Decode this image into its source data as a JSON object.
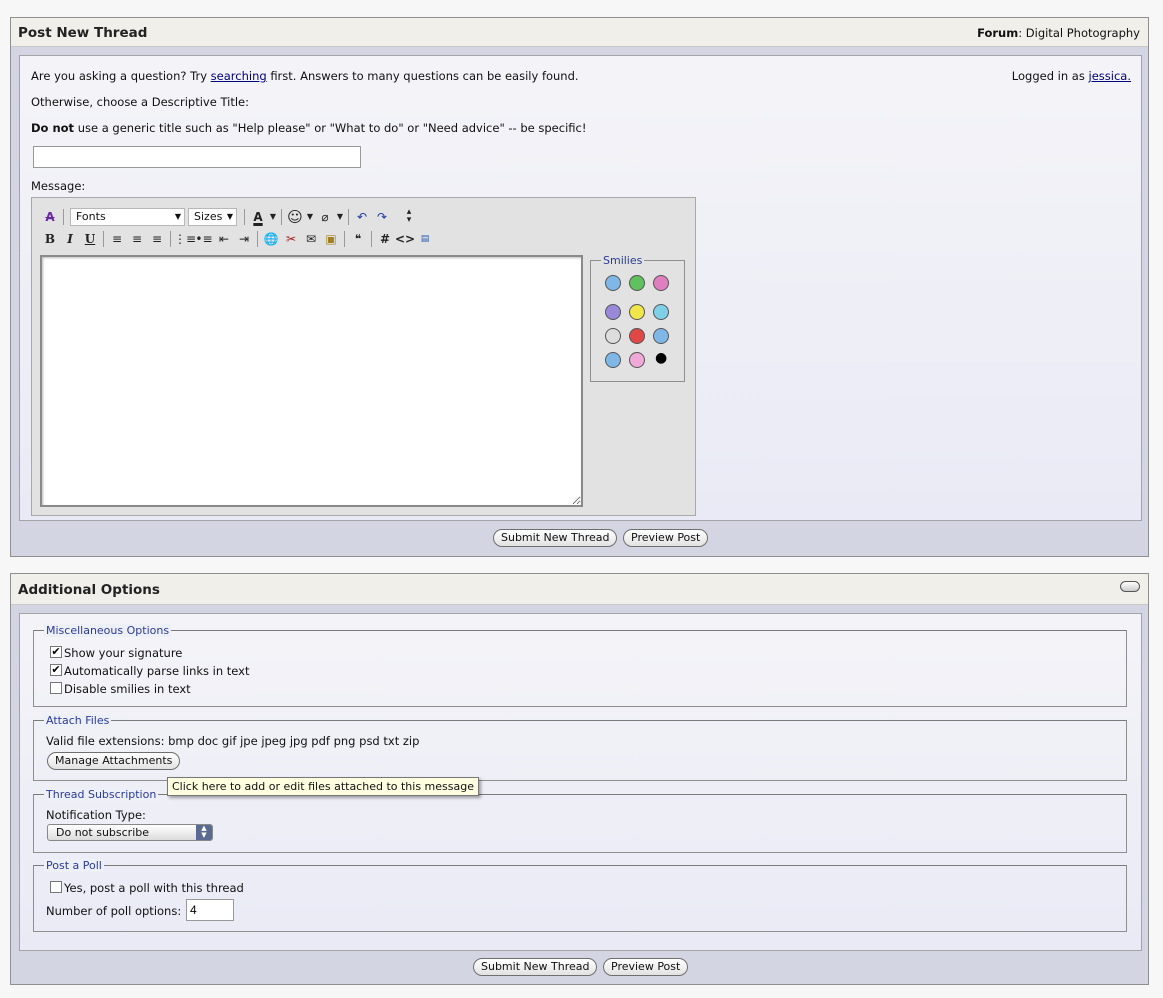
{
  "post_thread": {
    "title": "Post New Thread",
    "forum_label": "Forum",
    "forum_name": "Digital Photography",
    "intro_pre": "Are you asking a question? Try",
    "intro_link": "searching",
    "intro_post": "first. Answers to many questions can be easily found.",
    "logged_in_text": "Logged in as",
    "logged_in_user": "jessica.",
    "descriptive_title_prompt": "Otherwise, choose a Descriptive Title:",
    "warning_bold": "Do not",
    "warning_rest": "use a generic title such as \"Help please\" or \"What to do\" or \"Need advice\" -- be specific!",
    "title_input_value": "",
    "message_label": "Message:",
    "message_value": ""
  },
  "editor": {
    "font_select": "Fonts",
    "size_select": "Sizes",
    "smilies_legend": "Smilies",
    "smilies": [
      "smile-icon",
      "grin-icon",
      "tongue-icon",
      "frown-icon",
      "happy-icon",
      "confused-icon",
      "eek-icon",
      "mad-icon",
      "rolleyes-icon",
      "cool-icon",
      "wink-icon",
      "apple-icon"
    ],
    "colors": {
      "yellow": "#f0e64a",
      "blue": "#7fb8e6",
      "green": "#5fc25f",
      "pink": "#e07fc0",
      "red": "#e04848",
      "purple": "#9a88d8"
    }
  },
  "buttons": {
    "submit": "Submit New Thread",
    "preview": "Preview Post"
  },
  "additional": {
    "title": "Additional Options",
    "misc": {
      "legend": "Miscellaneous Options",
      "show_signature": "Show your signature",
      "show_signature_checked": true,
      "parse_links": "Automatically parse links in text",
      "parse_links_checked": true,
      "disable_smilies": "Disable smilies in text",
      "disable_smilies_checked": false
    },
    "attach": {
      "legend": "Attach Files",
      "extensions": "Valid file extensions: bmp doc gif jpe jpeg jpg pdf png psd txt zip",
      "manage_button": "Manage Attachments",
      "tooltip": "Click here to add or edit files attached to this message"
    },
    "subscription": {
      "legend": "Thread Subscription",
      "notification_label": "Notification Type:",
      "notification_value": "Do not subscribe"
    },
    "poll": {
      "legend": "Post a Poll",
      "yes_poll": "Yes, post a poll with this thread",
      "yes_poll_checked": false,
      "num_options_label": "Number of poll options:",
      "num_options_value": "4"
    }
  }
}
